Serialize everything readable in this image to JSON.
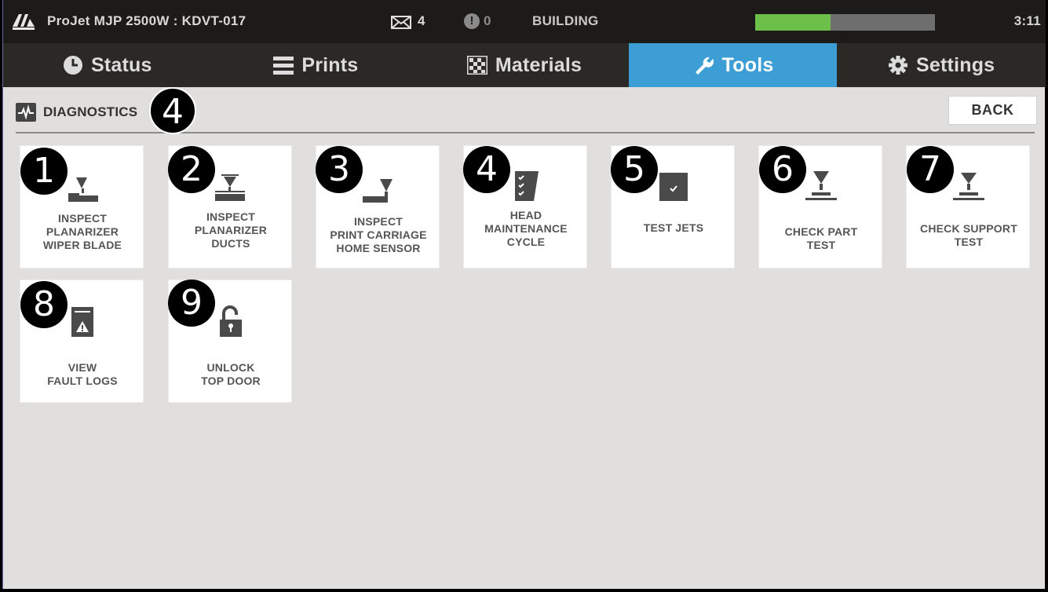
{
  "header": {
    "printer_title": "ProJet MJP 2500W : KDVT-017",
    "mail_count": "4",
    "alert_count": "0",
    "build_status": "BUILDING",
    "progress_fraction": 0.42,
    "clock": "3:11",
    "progress_color": "#6cc04a"
  },
  "tabs": [
    {
      "label": "Status",
      "icon": "clock-icon"
    },
    {
      "label": "Prints",
      "icon": "list-icon"
    },
    {
      "label": "Materials",
      "icon": "checker-icon"
    },
    {
      "label": "Tools",
      "icon": "wrench-icon",
      "active": true
    },
    {
      "label": "Settings",
      "icon": "gear-icon"
    }
  ],
  "accent_color": "#3d9ed6",
  "section": {
    "title": "DIAGNOSTICS",
    "back_label": "BACK",
    "callout": "4"
  },
  "tiles": [
    {
      "label": "INSPECT\nPLANARIZER\nWIPER BLADE",
      "callout": "1",
      "icon": "planarizer-blade-icon"
    },
    {
      "label": "INSPECT\nPLANARIZER\nDUCTS",
      "callout": "2",
      "icon": "planarizer-ducts-icon"
    },
    {
      "label": "INSPECT\nPRINT CARRIAGE\nHOME SENSOR",
      "callout": "3",
      "icon": "carriage-sensor-icon"
    },
    {
      "label": "HEAD\nMAINTENANCE\nCYCLE",
      "callout": "4",
      "icon": "checklist-icon"
    },
    {
      "label": "TEST JETS",
      "callout": "5",
      "icon": "test-jets-icon"
    },
    {
      "label": "CHECK PART\nTEST",
      "callout": "6",
      "icon": "check-part-icon"
    },
    {
      "label": "CHECK SUPPORT\nTEST",
      "callout": "7",
      "icon": "check-support-icon"
    },
    {
      "label": "VIEW\nFAULT LOGS",
      "callout": "8",
      "icon": "fault-log-icon"
    },
    {
      "label": "UNLOCK\nTOP DOOR",
      "callout": "9",
      "icon": "unlock-icon"
    }
  ]
}
